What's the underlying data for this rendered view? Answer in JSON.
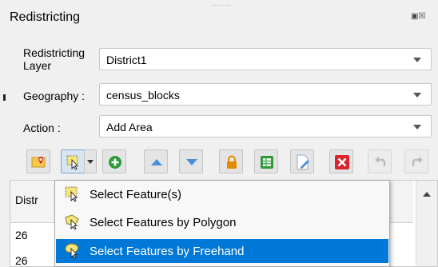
{
  "panel": {
    "title": "Redistricting",
    "window_buttons": "▣☒"
  },
  "fields": {
    "layer": {
      "label": "Redistricting Layer",
      "value": "District1"
    },
    "geography": {
      "label": "Geography :",
      "value": "census_blocks"
    },
    "action": {
      "label": "Action :",
      "value": "Add Area"
    }
  },
  "toolbar": {
    "buttons": [
      {
        "name": "map-marker-icon"
      },
      {
        "name": "select-features-icon"
      },
      {
        "name": "add-circle-icon"
      },
      {
        "name": "arrow-up-icon"
      },
      {
        "name": "arrow-down-icon"
      },
      {
        "name": "lock-icon"
      },
      {
        "name": "table-icon"
      },
      {
        "name": "edit-document-icon"
      },
      {
        "name": "delete-icon"
      },
      {
        "name": "undo-icon"
      },
      {
        "name": "redo-icon"
      }
    ]
  },
  "table": {
    "column_header": "Distr",
    "rows": [
      "26",
      "26"
    ]
  },
  "menu": {
    "items": [
      {
        "label": "Select Feature(s)",
        "icon": "select-feature-icon",
        "selected": false
      },
      {
        "label": "Select Features by Polygon",
        "icon": "select-polygon-icon",
        "selected": false
      },
      {
        "label": "Select Features by Freehand",
        "icon": "select-freehand-icon",
        "selected": true
      }
    ]
  },
  "colors": {
    "selection": "#0078d7",
    "add_green": "#2e9a3a",
    "lock_orange": "#e48a00",
    "delete_red": "#d9252b",
    "arrow_blue": "#4a90d9"
  }
}
